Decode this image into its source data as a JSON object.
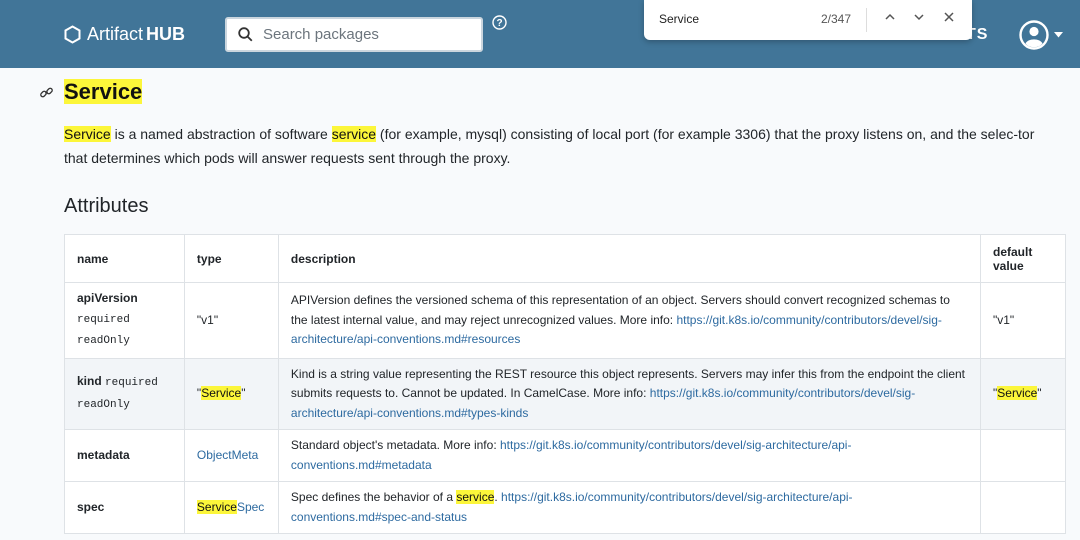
{
  "header": {
    "logo_text": "Artifact",
    "logo_bold": "HUB",
    "search_placeholder": "Search packages",
    "stats_fragment": "TS",
    "colors": {
      "bar": "#417598",
      "highlight": "#fcf63a",
      "link": "#2d6aa0"
    }
  },
  "findbar": {
    "query": "Service",
    "count": "2/347"
  },
  "section": {
    "title": "Service",
    "intro": {
      "hl1": "Service",
      "t1": " is a named abstraction of software ",
      "hl2": "service",
      "t2": " (for example, mysql) consisting of local port (for example 3306) that the proxy listens on, and the selec-tor that determines which pods will answer requests sent through the proxy."
    },
    "attributes_heading": "Attributes"
  },
  "table": {
    "headers": {
      "name": "name",
      "type": "type",
      "description": "description",
      "default": "default value"
    },
    "rows": {
      "apiVersion": {
        "name": "apiVersion",
        "flag1": "required",
        "flag2": "readOnly",
        "type": "\"v1\"",
        "desc": "APIVersion defines the versioned schema of this representation of an object. Servers should convert recognized schemas to the latest internal value, and may reject unrecognized values. More info: ",
        "link": "https://git.k8s.io/community/contributors/devel/sig-architecture/api-conventions.md#resources",
        "default": "\"v1\""
      },
      "kind": {
        "name": "kind",
        "flag1": "required",
        "flag2": "readOnly",
        "type_q1": "\"",
        "type_hl": "Service",
        "type_q2": "\"",
        "desc": "Kind is a string value representing the REST resource this object represents. Servers may infer this from the endpoint the client submits requests to. Cannot be updated. In CamelCase. More info: ",
        "link": "https://git.k8s.io/community/contributors/devel/sig-architecture/api-conventions.md#types-kinds",
        "def_q1": "\"",
        "def_hl": "Service",
        "def_q2": "\""
      },
      "metadata": {
        "name": "metadata",
        "type": "ObjectMeta",
        "desc": "Standard object's metadata. More info: ",
        "link": "https://git.k8s.io/community/contributors/devel/sig-architecture/api-conventions.md#metadata"
      },
      "spec": {
        "name": "spec",
        "type_hl": "Service",
        "type_rest": "Spec",
        "desc1": "Spec defines the behavior of a ",
        "desc_hl": "service",
        "desc2": ". ",
        "link": "https://git.k8s.io/community/contributors/devel/sig-architecture/api-conventions.md#spec-and-status"
      }
    }
  }
}
